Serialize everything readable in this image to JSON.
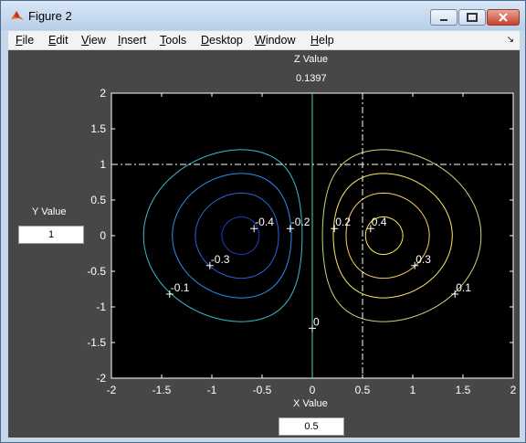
{
  "window": {
    "title": "Figure 2"
  },
  "menu": [
    {
      "first": "F",
      "rest": "ile"
    },
    {
      "first": "E",
      "rest": "dit"
    },
    {
      "first": "V",
      "rest": "iew"
    },
    {
      "first": "I",
      "rest": "nsert"
    },
    {
      "first": "T",
      "rest": "ools"
    },
    {
      "first": "D",
      "rest": "esktop"
    },
    {
      "first": "W",
      "rest": "indow"
    },
    {
      "first": "H",
      "rest": "elp"
    }
  ],
  "controls": {
    "z_label": "Z Value",
    "z_value": "0.1397",
    "y_label": "Y Value",
    "y_value": "1",
    "x_label": "X Value",
    "x_value": "0.5"
  },
  "chart_data": {
    "type": "contour",
    "xlim": [
      -2,
      2
    ],
    "ylim": [
      -2,
      2
    ],
    "x_ticks": [
      "-2",
      "-1.5",
      "-1",
      "-0.5",
      "0",
      "0.5",
      "1",
      "1.5",
      "2"
    ],
    "y_ticks": [
      "2",
      "1.5",
      "1",
      "0.5",
      "0",
      "-0.5",
      "-1",
      "-1.5",
      "-2"
    ],
    "levels": [
      -0.4,
      -0.3,
      -0.2,
      -0.1,
      0,
      0.1,
      0.2,
      0.3,
      0.4
    ],
    "contour_labels": [
      {
        "text": "-0.4",
        "x": -0.58,
        "y": 0.1
      },
      {
        "text": "-0.3",
        "x": -1.02,
        "y": -0.42
      },
      {
        "text": "-0.2",
        "x": -0.22,
        "y": 0.1
      },
      {
        "text": "-0.1",
        "x": -1.42,
        "y": -0.82
      },
      {
        "text": "0",
        "x": 0.0,
        "y": -1.3
      },
      {
        "text": "0.2",
        "x": 0.22,
        "y": 0.1
      },
      {
        "text": "0.4",
        "x": 0.58,
        "y": 0.1
      },
      {
        "text": "0.3",
        "x": 1.02,
        "y": -0.42
      },
      {
        "text": "0.1",
        "x": 1.42,
        "y": -0.82
      }
    ],
    "crosshair": {
      "x": 0.5,
      "y": 1
    },
    "background": "#000000"
  }
}
